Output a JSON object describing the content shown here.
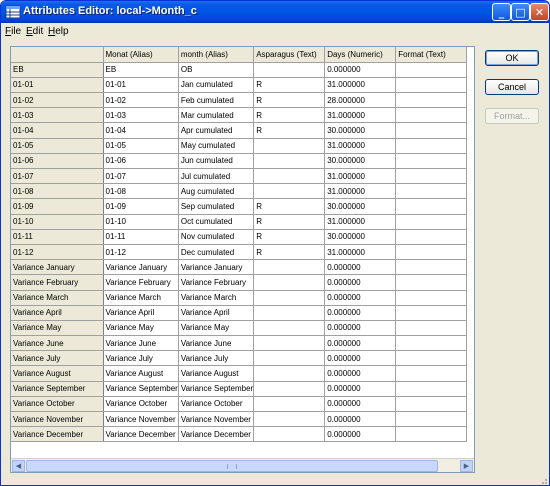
{
  "window": {
    "title": "Attributes Editor: local->Month_c"
  },
  "titlebar_buttons": {
    "minimize": "_",
    "maximize": "□",
    "close": "✕"
  },
  "menu": [
    {
      "mnemonic": "F",
      "rest": "ile"
    },
    {
      "mnemonic": "E",
      "rest": "dit"
    },
    {
      "mnemonic": "H",
      "rest": "elp"
    }
  ],
  "grid": {
    "columns": [
      "Monat (Alias)",
      "month (Alias)",
      "Asparagus (Text)",
      "Days (Numeric)",
      "Format (Text)"
    ],
    "rows": [
      {
        "header": "EB",
        "cells": [
          "EB",
          "OB",
          "",
          "0.000000",
          ""
        ]
      },
      {
        "header": "01-01",
        "cells": [
          "01-01",
          "Jan cumulated",
          "R",
          "31.000000",
          ""
        ]
      },
      {
        "header": "01-02",
        "cells": [
          "01-02",
          "Feb cumulated",
          "R",
          "28.000000",
          ""
        ]
      },
      {
        "header": "01-03",
        "cells": [
          "01-03",
          "Mar cumulated",
          "R",
          "31.000000",
          ""
        ]
      },
      {
        "header": "01-04",
        "cells": [
          "01-04",
          "Apr cumulated",
          "R",
          "30.000000",
          ""
        ]
      },
      {
        "header": "01-05",
        "cells": [
          "01-05",
          "May cumulated",
          "",
          "31.000000",
          ""
        ]
      },
      {
        "header": "01-06",
        "cells": [
          "01-06",
          "Jun cumulated",
          "",
          "30.000000",
          ""
        ]
      },
      {
        "header": "01-07",
        "cells": [
          "01-07",
          "Jul cumulated",
          "",
          "31.000000",
          ""
        ]
      },
      {
        "header": "01-08",
        "cells": [
          "01-08",
          "Aug cumulated",
          "",
          "31.000000",
          ""
        ]
      },
      {
        "header": "01-09",
        "cells": [
          "01-09",
          "Sep cumulated",
          "R",
          "30.000000",
          ""
        ]
      },
      {
        "header": "01-10",
        "cells": [
          "01-10",
          "Oct cumulated",
          "R",
          "31.000000",
          ""
        ]
      },
      {
        "header": "01-11",
        "cells": [
          "01-11",
          "Nov cumulated",
          "R",
          "30.000000",
          ""
        ]
      },
      {
        "header": "01-12",
        "cells": [
          "01-12",
          "Dec cumulated",
          "R",
          "31.000000",
          ""
        ]
      },
      {
        "header": "Variance January",
        "cells": [
          "Variance January",
          "Variance January",
          "",
          "0.000000",
          ""
        ]
      },
      {
        "header": "Variance February",
        "cells": [
          "Variance February",
          "Variance February",
          "",
          "0.000000",
          ""
        ]
      },
      {
        "header": "Variance March",
        "cells": [
          "Variance March",
          "Variance March",
          "",
          "0.000000",
          ""
        ]
      },
      {
        "header": "Variance April",
        "cells": [
          "Variance April",
          "Variance April",
          "",
          "0.000000",
          ""
        ]
      },
      {
        "header": "Variance May",
        "cells": [
          "Variance May",
          "Variance May",
          "",
          "0.000000",
          ""
        ]
      },
      {
        "header": "Variance June",
        "cells": [
          "Variance June",
          "Variance June",
          "",
          "0.000000",
          ""
        ]
      },
      {
        "header": "Variance July",
        "cells": [
          "Variance July",
          "Variance July",
          "",
          "0.000000",
          ""
        ]
      },
      {
        "header": "Variance August",
        "cells": [
          "Variance August",
          "Variance August",
          "",
          "0.000000",
          ""
        ]
      },
      {
        "header": "Variance September",
        "cells": [
          "Variance September",
          "Variance September",
          "",
          "0.000000",
          ""
        ]
      },
      {
        "header": "Variance October",
        "cells": [
          "Variance October",
          "Variance October",
          "",
          "0.000000",
          ""
        ]
      },
      {
        "header": "Variance November",
        "cells": [
          "Variance November",
          "Variance November",
          "",
          "0.000000",
          ""
        ]
      },
      {
        "header": "Variance December",
        "cells": [
          "Variance December",
          "Variance December",
          "",
          "0.000000",
          ""
        ]
      }
    ]
  },
  "buttons": {
    "ok": "OK",
    "cancel": "Cancel",
    "format": "Format..."
  },
  "colors": {
    "titlebar": "#0055e5",
    "window_bg": "#ece9d8",
    "grid_line": "#a0a0a0",
    "disabled_text": "#a0a0a0"
  }
}
